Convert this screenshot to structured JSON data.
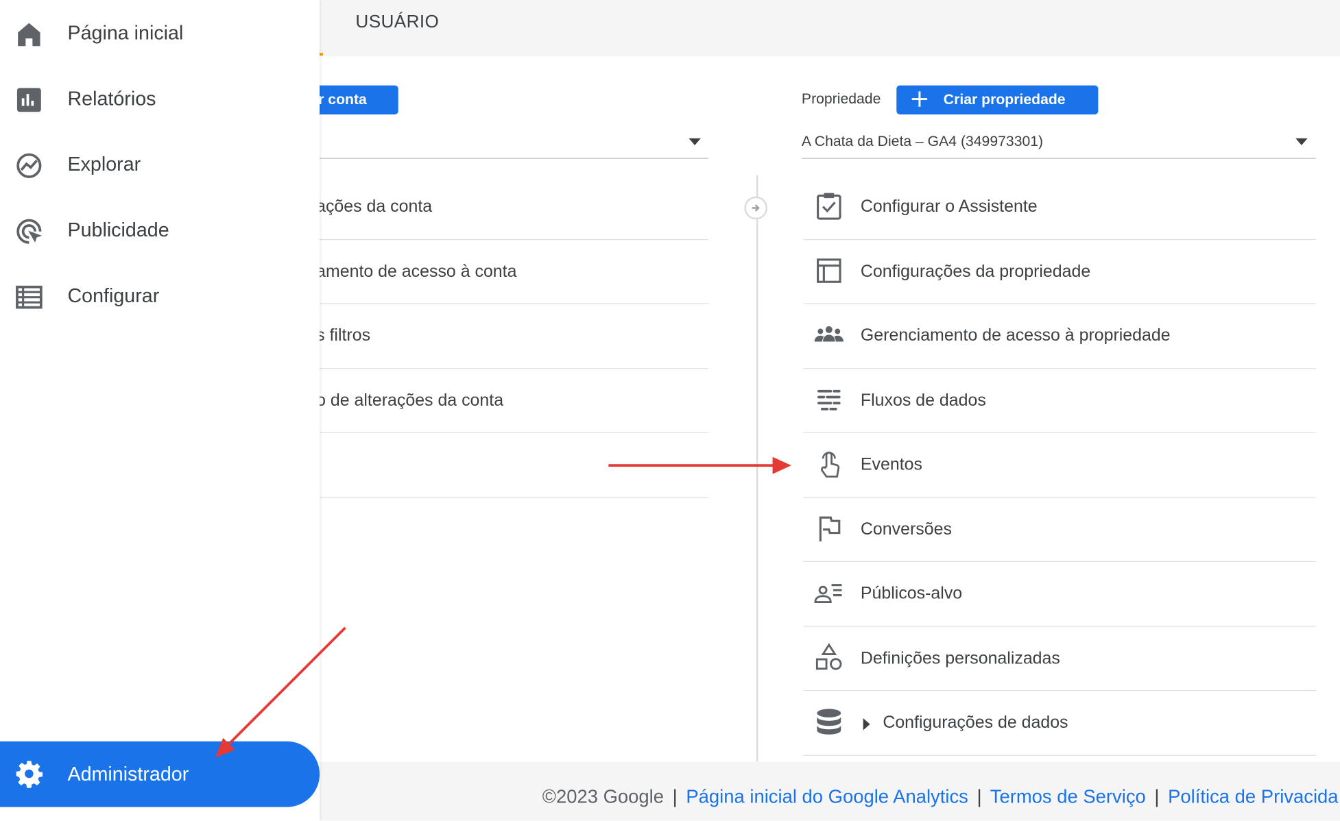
{
  "header": {
    "tab_label": "USUÁRIO"
  },
  "nav": {
    "items": [
      {
        "label": "Página inicial",
        "icon": "home-icon"
      },
      {
        "label": "Relatórios",
        "icon": "bar-chart-icon"
      },
      {
        "label": "Explorar",
        "icon": "explore-icon"
      },
      {
        "label": "Publicidade",
        "icon": "ads-target-icon"
      },
      {
        "label": "Configurar",
        "icon": "list-icon"
      }
    ],
    "admin": {
      "label": "Administrador",
      "icon": "gear-icon"
    }
  },
  "account": {
    "create_label": "ar conta",
    "items": [
      "ações da conta",
      "amento de acesso à conta",
      "s filtros",
      "o de alterações da conta"
    ]
  },
  "property": {
    "label": "Propriedade",
    "create_label": "Criar propriedade",
    "selected": "A Chata da Dieta – GA4 (349973301)",
    "items": [
      {
        "label": "Configurar o Assistente",
        "icon": "checklist-icon"
      },
      {
        "label": "Configurações da propriedade",
        "icon": "layout-icon"
      },
      {
        "label": "Gerenciamento de acesso à propriedade",
        "icon": "people-icon"
      },
      {
        "label": "Fluxos de dados",
        "icon": "data-streams-icon"
      },
      {
        "label": "Eventos",
        "icon": "touch-icon"
      },
      {
        "label": "Conversões",
        "icon": "flag-icon"
      },
      {
        "label": "Públicos-alvo",
        "icon": "audience-icon"
      },
      {
        "label": "Definições personalizadas",
        "icon": "shapes-icon"
      },
      {
        "label": "Configurações de dados",
        "icon": "database-icon"
      }
    ]
  },
  "footer": {
    "copyright": "©2023 Google",
    "sep": "|",
    "links": [
      "Página inicial do Google Analytics",
      "Termos de Serviço",
      "Política de Privacida"
    ]
  },
  "colors": {
    "accent": "#1a73e8",
    "annotation": "#e53935",
    "icon": "#5f6368"
  }
}
